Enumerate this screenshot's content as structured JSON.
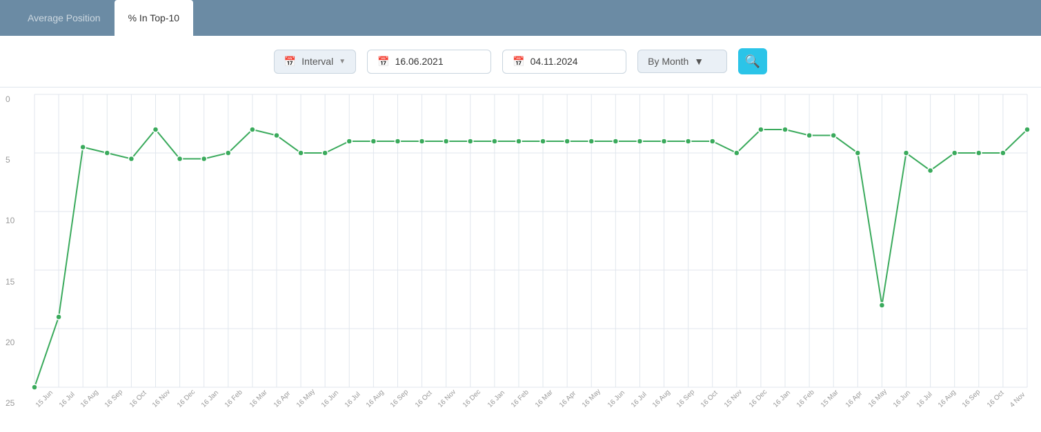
{
  "header": {
    "tab1_label": "Average Position",
    "tab2_label": "% In Top-10"
  },
  "toolbar": {
    "interval_label": "Interval",
    "date_from": "16.06.2021",
    "date_to": "04.11.2024",
    "period_label": "By Month",
    "search_icon": "🔍"
  },
  "chart": {
    "y_labels": [
      "0",
      "5",
      "10",
      "15",
      "20",
      "25"
    ],
    "x_labels": [
      "15 Jun",
      "16 Jul",
      "16 Aug",
      "16 Sep",
      "16 Oct",
      "16 Nov",
      "16 Dec",
      "16 Jan",
      "16 Feb",
      "16 Mar",
      "16 Apr",
      "16 May",
      "16 Jun",
      "16 Jul",
      "16 Aug",
      "16 Sep",
      "16 Oct",
      "16 Nov",
      "16 Dec",
      "16 Jan",
      "16 Feb",
      "16 Mar",
      "16 Apr",
      "16 May",
      "16 Jun",
      "16 Jul",
      "16 Aug",
      "16 Sep",
      "16 Oct",
      "15 Nov",
      "16 Dec",
      "16 Jan",
      "16 Feb",
      "15 Mar",
      "16 Apr",
      "16 May",
      "16 Jun",
      "16 Jul",
      "16 Aug",
      "16 Sep",
      "16 Oct",
      "4 Nov"
    ]
  }
}
